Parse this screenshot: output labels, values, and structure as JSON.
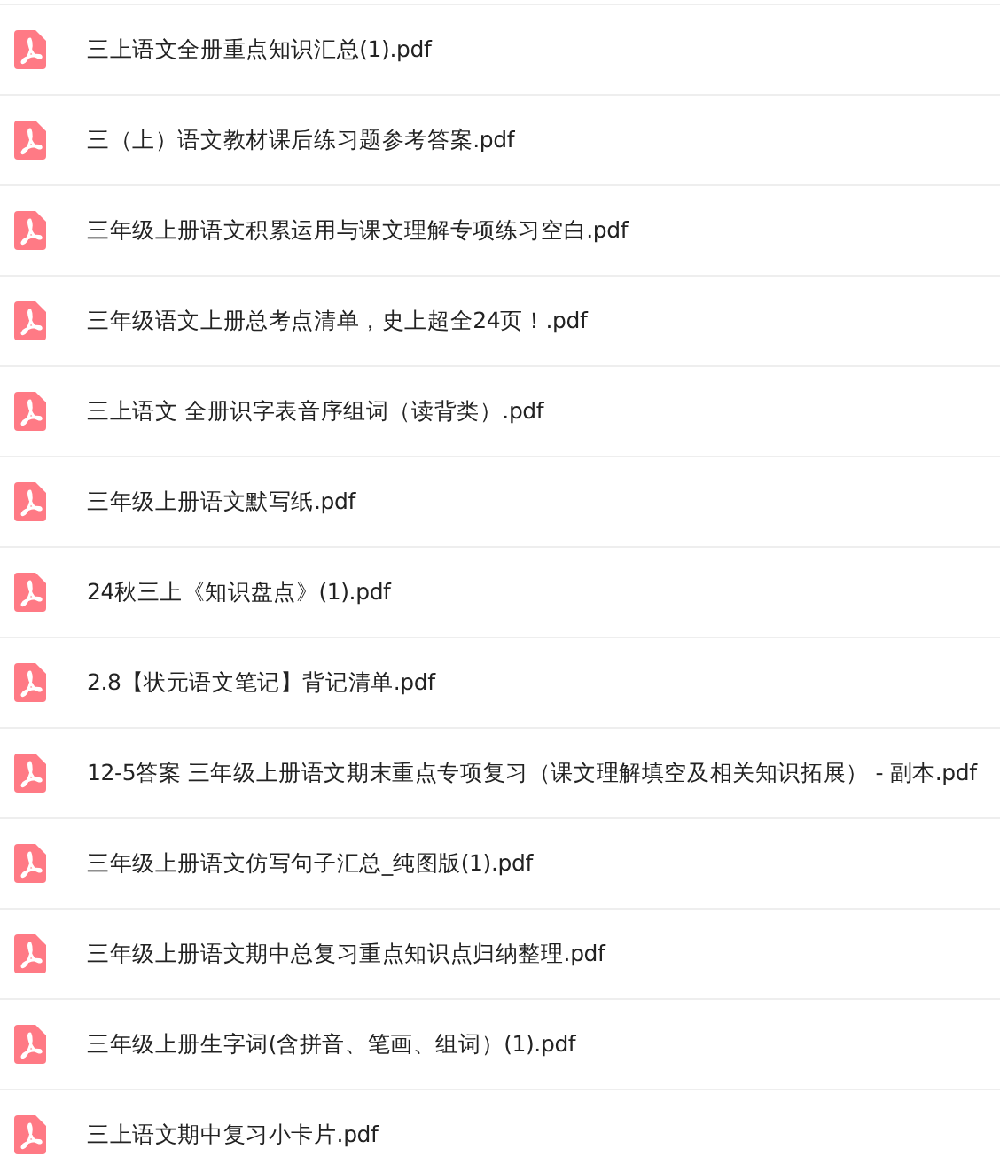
{
  "files": [
    {
      "name": "三上语文全册重点知识汇总(1).pdf"
    },
    {
      "name": "三（上）语文教材课后练习题参考答案.pdf"
    },
    {
      "name": "三年级上册语文积累运用与课文理解专项练习空白.pdf"
    },
    {
      "name": "三年级语文上册总考点清单，史上超全24页！.pdf"
    },
    {
      "name": "三上语文 全册识字表音序组词（读背类）.pdf"
    },
    {
      "name": "三年级上册语文默写纸.pdf"
    },
    {
      "name": "24秋三上《知识盘点》(1).pdf"
    },
    {
      "name": "2.8【状元语文笔记】背记清单.pdf"
    },
    {
      "name": "12-5答案 三年级上册语文期末重点专项复习（课文理解填空及相关知识拓展） - 副本.pdf"
    },
    {
      "name": "三年级上册语文仿写句子汇总_纯图版(1).pdf"
    },
    {
      "name": "三年级上册语文期中总复习重点知识点归纳整理.pdf"
    },
    {
      "name": "三年级上册生字词(含拼音、笔画、组词）(1).pdf"
    },
    {
      "name": "三上语文期中复习小卡片.pdf"
    }
  ]
}
